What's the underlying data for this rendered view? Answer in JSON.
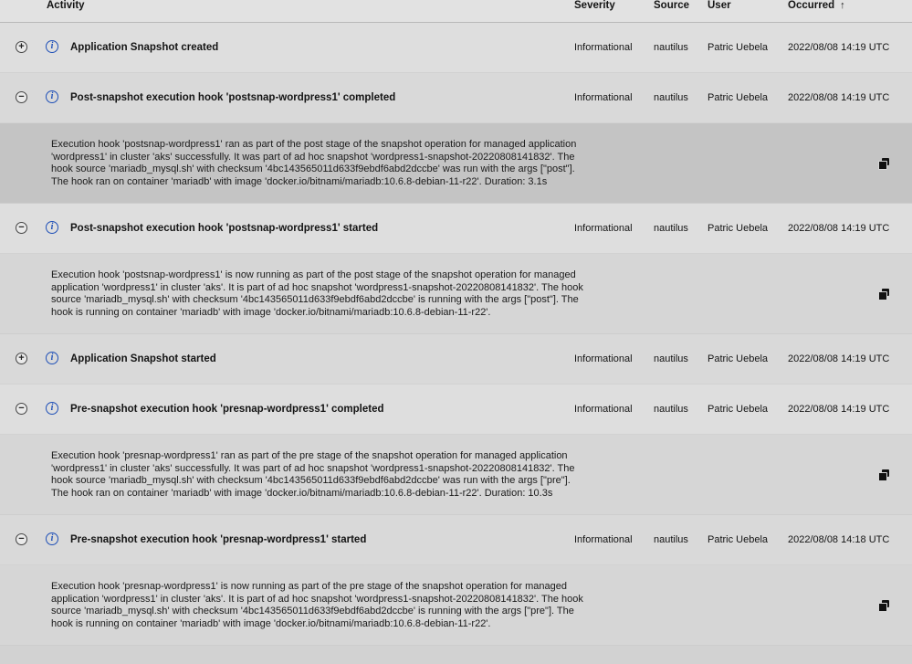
{
  "header": {
    "activity": "Activity",
    "severity": "Severity",
    "source": "Source",
    "user": "User",
    "occurred": "Occurred",
    "sort_icon": "arrow-up-icon"
  },
  "events": [
    {
      "toggle": "+",
      "activity": "Application Snapshot created",
      "severity": "Informational",
      "source": "nautilus",
      "user": "Patric Uebela",
      "occurred": "2022/08/08 14:19 UTC"
    },
    {
      "toggle": "−",
      "activity": "Post-snapshot execution hook 'postsnap-wordpress1' completed",
      "severity": "Informational",
      "source": "nautilus",
      "user": "Patric Uebela",
      "occurred": "2022/08/08 14:19 UTC",
      "detail_lines": [
        "Execution hook 'postsnap-wordpress1' ran as part of the post stage of the snapshot operation for managed application",
        "'wordpress1' in cluster 'aks' successfully. It was part of ad hoc snapshot 'wordpress1-snapshot-20220808141832'. The",
        "hook source 'mariadb_mysql.sh' with checksum '4bc143565011d633f9ebdf6abd2dccbe' was run with the args [\"post\"].",
        "The hook ran on container 'mariadb' with image 'docker.io/bitnami/mariadb:10.6.8-debian-11-r22'. Duration: 3.1s"
      ]
    },
    {
      "toggle": "−",
      "activity": "Post-snapshot execution hook 'postsnap-wordpress1' started",
      "severity": "Informational",
      "source": "nautilus",
      "user": "Patric Uebela",
      "occurred": "2022/08/08 14:19 UTC",
      "detail_lines": [
        "Execution hook 'postsnap-wordpress1' is now running as part of the post stage of the snapshot operation for managed",
        "application 'wordpress1' in cluster 'aks'. It is part of ad hoc snapshot 'wordpress1-snapshot-20220808141832'. The hook",
        "source 'mariadb_mysql.sh' with checksum '4bc143565011d633f9ebdf6abd2dccbe' is running with the args [\"post\"]. The",
        "hook is running on container 'mariadb' with image 'docker.io/bitnami/mariadb:10.6.8-debian-11-r22'."
      ]
    },
    {
      "toggle": "+",
      "activity": "Application Snapshot started",
      "severity": "Informational",
      "source": "nautilus",
      "user": "Patric Uebela",
      "occurred": "2022/08/08 14:19 UTC"
    },
    {
      "toggle": "−",
      "activity": "Pre-snapshot execution hook 'presnap-wordpress1' completed",
      "severity": "Informational",
      "source": "nautilus",
      "user": "Patric Uebela",
      "occurred": "2022/08/08 14:19 UTC",
      "detail_lines": [
        "Execution hook 'presnap-wordpress1' ran as part of the pre stage of the snapshot operation for managed application",
        "'wordpress1' in cluster 'aks' successfully. It was part of ad hoc snapshot 'wordpress1-snapshot-20220808141832'. The",
        "hook source 'mariadb_mysql.sh' with checksum '4bc143565011d633f9ebdf6abd2dccbe' was run with the args [\"pre\"].",
        "The hook ran on container 'mariadb' with image 'docker.io/bitnami/mariadb:10.6.8-debian-11-r22'. Duration: 10.3s"
      ]
    },
    {
      "toggle": "−",
      "activity": "Pre-snapshot execution hook 'presnap-wordpress1' started",
      "severity": "Informational",
      "source": "nautilus",
      "user": "Patric Uebela",
      "occurred": "2022/08/08 14:18 UTC",
      "detail_lines": [
        "Execution hook 'presnap-wordpress1' is now running as part of the pre stage of the snapshot operation for managed",
        "application 'wordpress1' in cluster 'aks'. It is part of ad hoc snapshot 'wordpress1-snapshot-20220808141832'. The hook",
        "source 'mariadb_mysql.sh' with checksum '4bc143565011d633f9ebdf6abd2dccbe' is running with the args [\"pre\"]. The",
        "hook is running on container 'mariadb' with image 'docker.io/bitnami/mariadb:10.6.8-debian-11-r22'."
      ]
    }
  ]
}
